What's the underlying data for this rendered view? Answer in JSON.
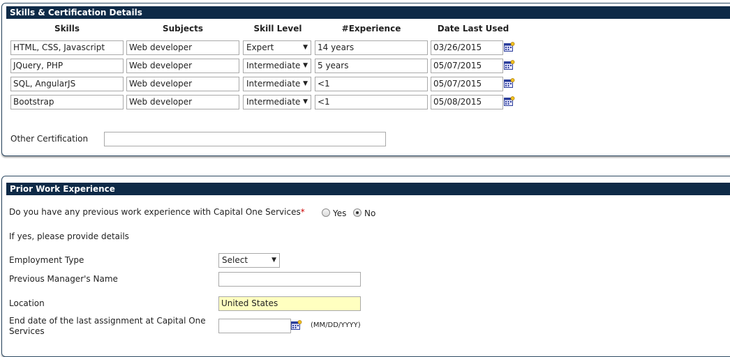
{
  "skills_section": {
    "title": "Skills & Certification Details",
    "headers": [
      "Skills",
      "Subjects",
      "Skill Level",
      "#Experience",
      "Date Last Used"
    ],
    "rows": [
      {
        "skill": "HTML, CSS, Javascript",
        "subject": "Web developer",
        "level": "Expert",
        "experience": "14 years",
        "date": "03/26/2015"
      },
      {
        "skill": "JQuery, PHP",
        "subject": "Web developer",
        "level": "Intermediate",
        "experience": "5 years",
        "date": "05/07/2015"
      },
      {
        "skill": "SQL, AngularJS",
        "subject": "Web developer",
        "level": "Intermediate",
        "experience": "<1",
        "date": "05/07/2015"
      },
      {
        "skill": "Bootstrap",
        "subject": "Web developer",
        "level": "Intermediate",
        "experience": "<1",
        "date": "05/08/2015"
      }
    ],
    "other_certification_label": "Other Certification",
    "other_certification_value": ""
  },
  "work_section": {
    "title": "Prior Work Experience",
    "question": "Do you have any previous work experience with Capital One Services",
    "required_mark": "*",
    "options": [
      "Yes",
      "No"
    ],
    "selected_option": "No",
    "details_prompt": "If yes, please provide details",
    "employment_type_label": "Employment Type",
    "employment_type_value": "Select",
    "manager_label": "Previous Manager's Name",
    "manager_value": "",
    "location_label": "Location",
    "location_value": "United States",
    "end_date_label": "End date of the last assignment at Capital One Services",
    "end_date_value": "",
    "date_format_hint": "(MM/DD/YYYY)"
  },
  "icons": {
    "calendar": "calendar-icon",
    "dropdown": "chevron-down-icon"
  },
  "colors": {
    "header_bg": "#0e2a47",
    "highlight_field": "#ffffc0",
    "required": "#cc0000"
  }
}
